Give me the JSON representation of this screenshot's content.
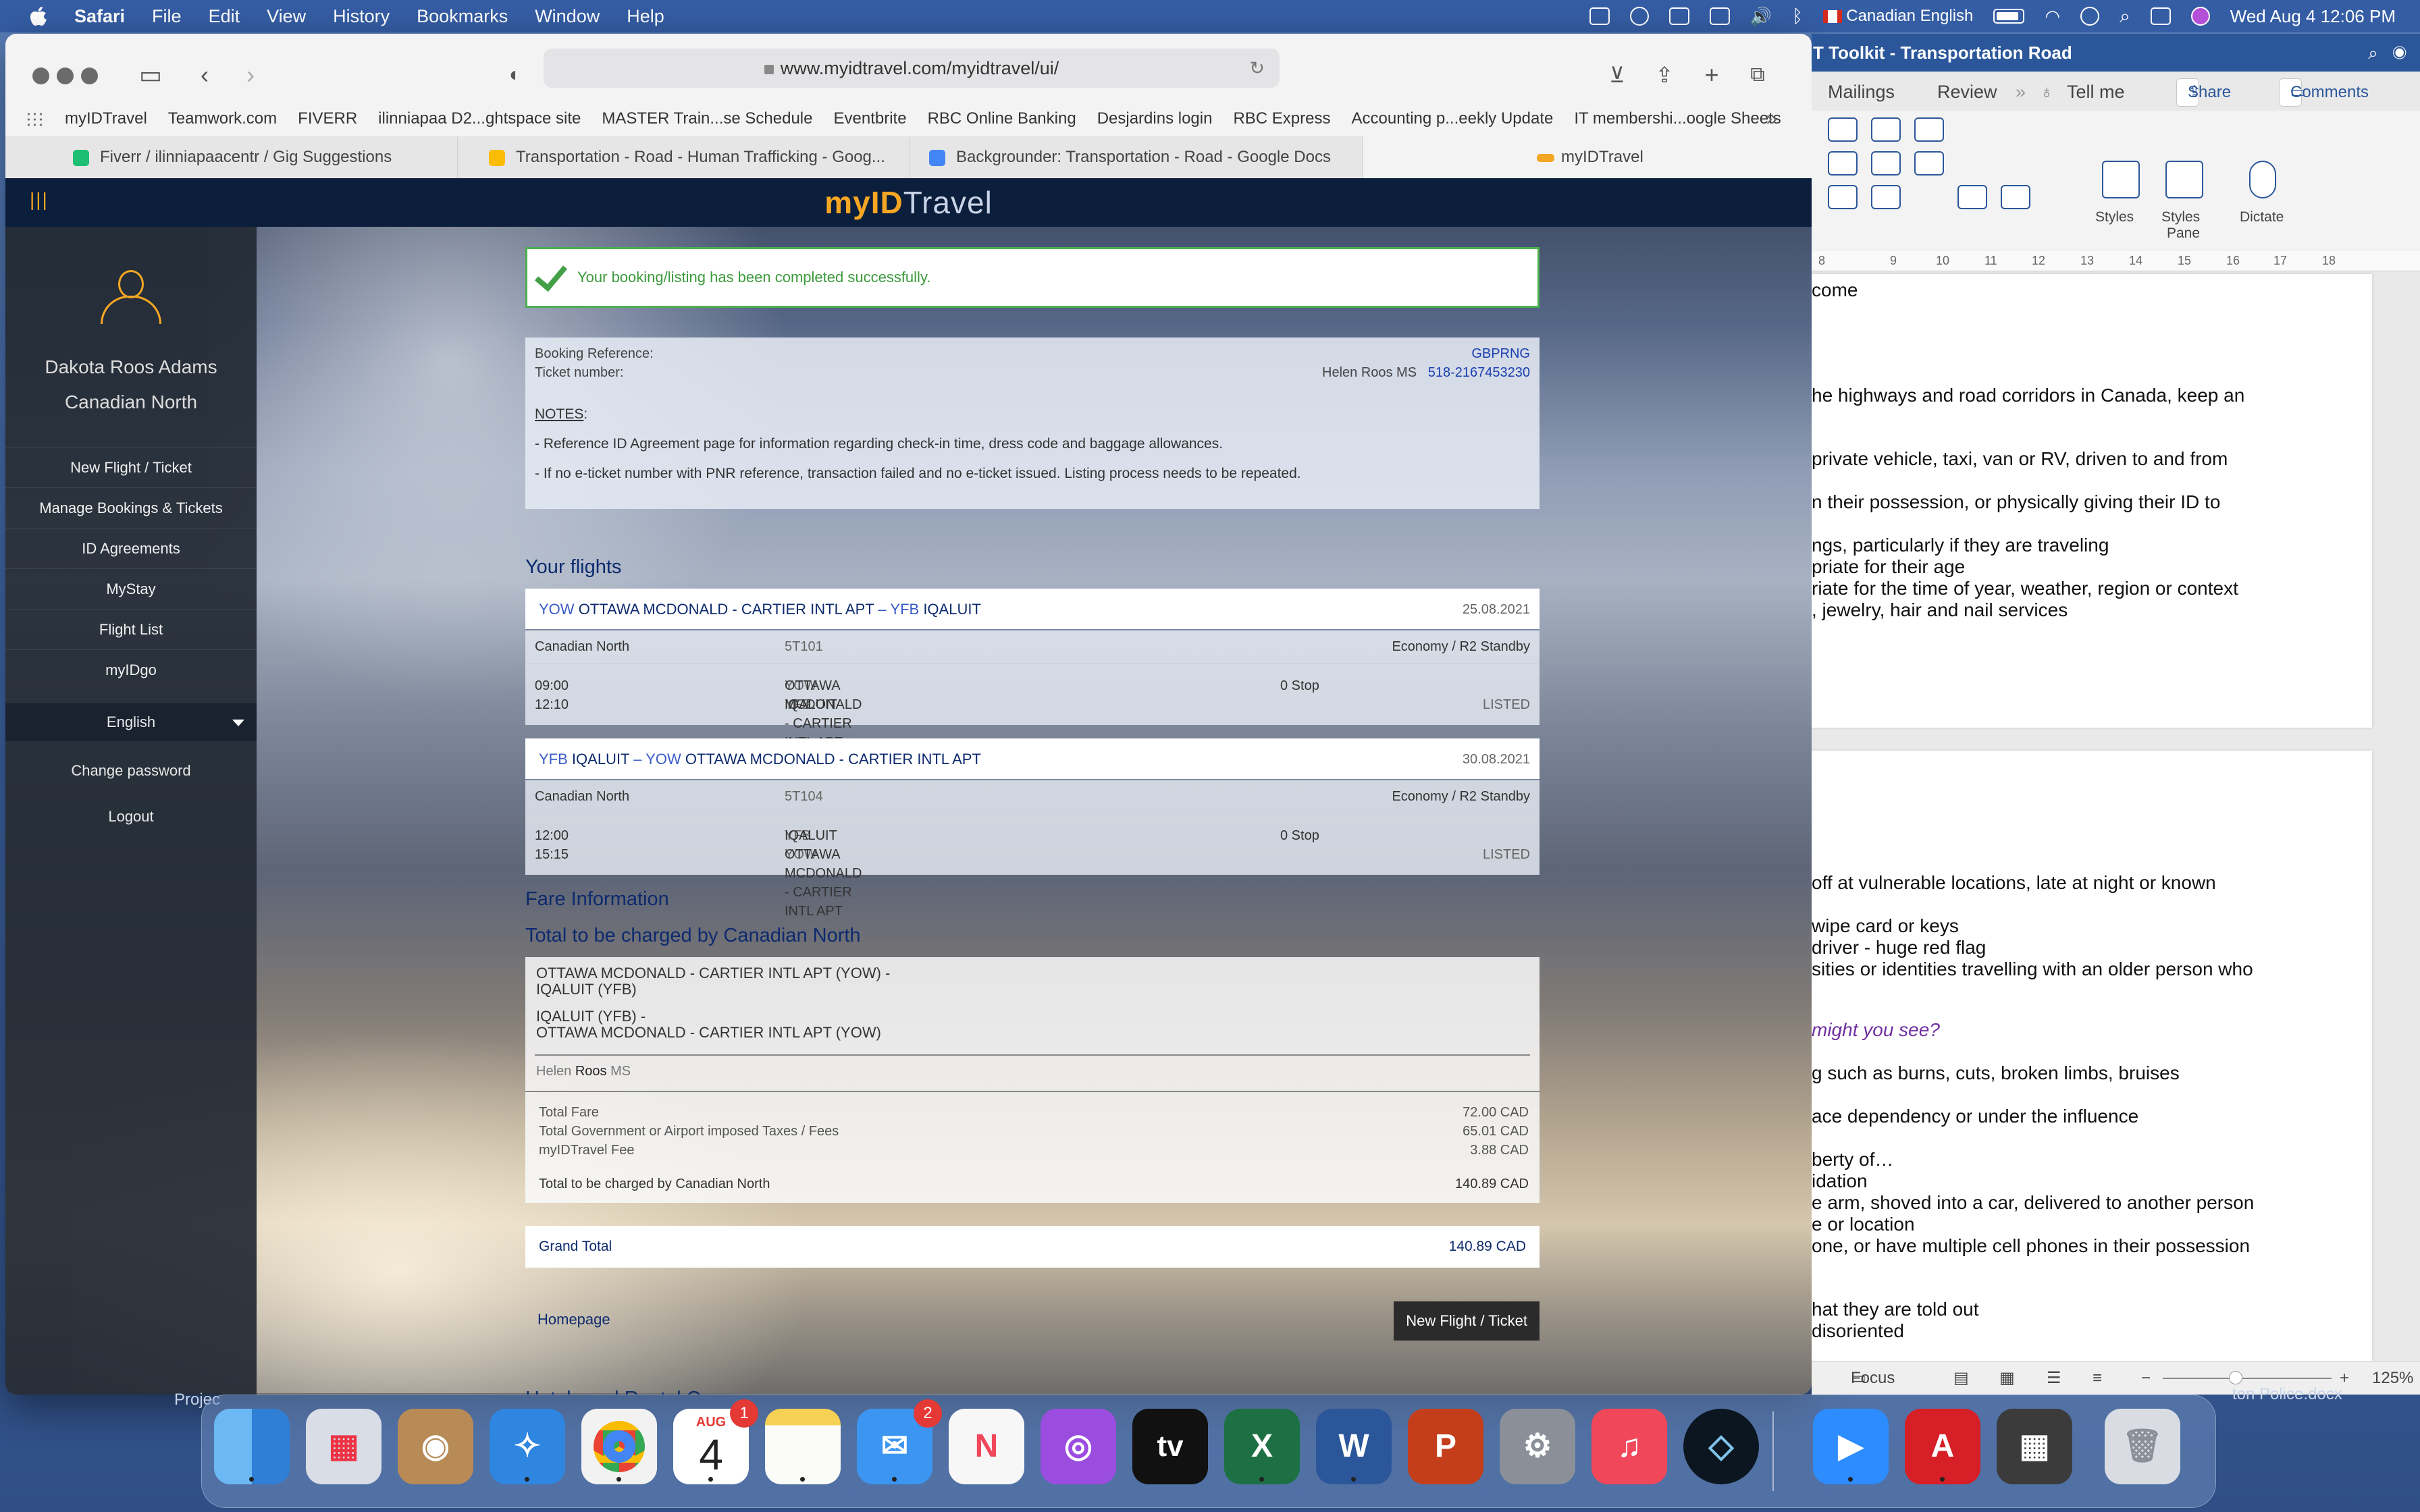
{
  "menubar": {
    "app": "Safari",
    "items": [
      "File",
      "Edit",
      "View",
      "History",
      "Bookmarks",
      "Window",
      "Help"
    ],
    "input_source": "Canadian English",
    "clock": "Wed Aug 4  12:06 PM"
  },
  "browser": {
    "url": "www.myidtravel.com/myidtravel/ui/",
    "favorites": [
      "myIDTravel",
      "Teamwork.com",
      "FIVERR",
      "ilinniapaa D2...ghtspace site",
      "MASTER Train...se Schedule",
      "Eventbrite",
      "RBC Online Banking",
      "Desjardins login",
      "RBC Express",
      "Accounting p...eekly Update",
      "IT membershi...oogle Sheets"
    ],
    "tabs": [
      {
        "label": "Fiverr / ilinniapaacentr / Gig Suggestions",
        "color": "#1dbf73"
      },
      {
        "label": "Transportation - Road - Human Trafficking - Goog...",
        "color": "#fbbc04"
      },
      {
        "label": "Backgrounder: Transportation - Road - Google Docs",
        "color": "#4285f4"
      },
      {
        "label": "myIDTravel",
        "color": "#f5a623"
      }
    ]
  },
  "site": {
    "menu_label": "Menu",
    "logo_a": "myID",
    "logo_b": "Travel"
  },
  "sidebar": {
    "user_name": "Dakota Roos Adams",
    "airline": "Canadian North",
    "items": [
      "New Flight / Ticket",
      "Manage Bookings & Tickets",
      "ID Agreements",
      "MyStay",
      "Flight List",
      "myIDgo"
    ],
    "language": "English",
    "change_password": "Change password",
    "logout": "Logout"
  },
  "booking": {
    "success": "Your booking/listing has been completed successfully.",
    "ref_label": "Booking Reference:",
    "ref_value": "GBPRNG",
    "ticket_label": "Ticket number:",
    "passenger": "Helen Roos MS",
    "ticket_value": "518-2167453230",
    "notes_title": "NOTES",
    "notes_colon": ":",
    "note1": "- Reference ID Agreement page for information regarding check-in time, dress code and baggage allowances.",
    "note2": "- If no e-ticket number with PNR reference, transaction failed and no e-ticket issued. Listing process needs to be repeated."
  },
  "flights_title": "Your flights",
  "flights": [
    {
      "from_code": "YOW",
      "from_name": "OTTAWA MCDONALD - CARTIER INTL APT",
      "to_code": "YFB",
      "to_name": "IQALUIT",
      "date": "25.08.2021",
      "airline": "Canadian North",
      "flight_no": "5T101",
      "cabin": "Economy / R2 Standby",
      "dep_time": "09:00",
      "arr_time": "12:10",
      "dep_code": "YOW",
      "dep_name": "OTTAWA MCDONALD - CARTIER INTL APT",
      "arr_code": "YFB",
      "arr_name": "IQALUIT",
      "stops": "0 Stop",
      "status": "LISTED"
    },
    {
      "from_code": "YFB",
      "from_name": "IQALUIT",
      "to_code": "YOW",
      "to_name": "OTTAWA MCDONALD - CARTIER INTL APT",
      "date": "30.08.2021",
      "airline": "Canadian North",
      "flight_no": "5T104",
      "cabin": "Economy / R2 Standby",
      "dep_time": "12:00",
      "arr_time": "15:15",
      "dep_code": "YFB",
      "dep_name": "IQALUIT",
      "arr_code": "YOW",
      "arr_name": "OTTAWA MCDONALD - CARTIER INTL APT",
      "stops": "0 Stop",
      "status": "LISTED"
    }
  ],
  "fare": {
    "title": "Fare Information",
    "subtitle": "Total to be charged by Canadian North",
    "route1a": "OTTAWA MCDONALD - CARTIER INTL APT (YOW) -",
    "route1b": "IQALUIT (YFB)",
    "route2a": "IQALUIT (YFB) -",
    "route2b": "OTTAWA MCDONALD - CARTIER INTL APT (YOW)",
    "pax_first": "Helen",
    "pax_last": "Roos",
    "pax_title": "MS",
    "total_fare_label": "Total Fare",
    "total_fare": "72.00 CAD",
    "taxes_label": "Total Government or Airport imposed Taxes / Fees",
    "taxes": "65.01 CAD",
    "fee_label": "myIDTravel Fee",
    "fee": "3.88 CAD",
    "charged_label": "Total to be charged by Canadian North",
    "charged": "140.89 CAD",
    "grand_label": "Grand Total",
    "grand": "140.89 CAD"
  },
  "homepage_link": "Homepage",
  "new_flight_button": "New Flight / Ticket",
  "hotels_title": "Hotels and Rental Cars",
  "word": {
    "title": "T Toolkit - Transportation Road",
    "tabs": [
      "Mailings",
      "Review",
      "Tell me"
    ],
    "share": "Share",
    "comments": "Comments",
    "ribbon_styles": "Styles",
    "ribbon_pane_1": "Styles",
    "ribbon_pane_2": "Pane",
    "ribbon_dictate": "Dictate",
    "ruler": [
      "8",
      "9",
      "10",
      "11",
      "12",
      "13",
      "14",
      "15",
      "16",
      "17",
      "18"
    ],
    "page1": [
      "come",
      "he highways and road corridors in Canada, keep an",
      "private vehicle, taxi, van or RV, driven to and from",
      "n their possession, or physically giving their ID to",
      "ngs, particularly if they are traveling",
      "priate for their age",
      "riate for the time of year, weather, region or context",
      ", jewelry, hair and nail services"
    ],
    "page2": [
      "off at vulnerable locations, late at night or known",
      "wipe card or keys",
      " driver - huge red flag",
      "sities or identities travelling with an older person who",
      "might you see?",
      "g such as burns, cuts, broken limbs, bruises",
      "ace dependency or under the influence",
      "berty of…",
      "idation",
      "e arm, shoved into a car, delivered to another person",
      "e or location",
      "one, or have multiple cell phones in their possession",
      "hat they are told out",
      " disoriented"
    ],
    "focus": "Focus",
    "zoom": "125%"
  },
  "desktop": {
    "left_label": "Projec",
    "right_label": "ton Police.docx"
  },
  "dock": [
    {
      "name": "Finder",
      "color": "#3a8ee6"
    },
    {
      "name": "Launchpad",
      "color": "#d8dde6"
    },
    {
      "name": "Contacts",
      "color": "#b88a55"
    },
    {
      "name": "Safari",
      "color": "#2f86e0"
    },
    {
      "name": "Chrome",
      "color": "#f2f2f2"
    },
    {
      "name": "Calendar",
      "color": "#ffffff",
      "text": "4",
      "month": "AUG",
      "badge": "1"
    },
    {
      "name": "Notes",
      "color": "#f7d154"
    },
    {
      "name": "Mail",
      "color": "#3c95f0",
      "badge": "2"
    },
    {
      "name": "News",
      "color": "#f7f7f7"
    },
    {
      "name": "Podcasts",
      "color": "#9b4de0"
    },
    {
      "name": "Apple TV",
      "color": "#111111",
      "text": "tv"
    },
    {
      "name": "Excel",
      "color": "#1d7044",
      "text": "X"
    },
    {
      "name": "Word",
      "color": "#2b579a",
      "text": "W"
    },
    {
      "name": "PowerPoint",
      "color": "#c43e1c",
      "text": "P"
    },
    {
      "name": "System Preferences",
      "color": "#8a8f98"
    },
    {
      "name": "Music",
      "color": "#f0475b"
    },
    {
      "name": "App",
      "color": "#0b1620"
    },
    {
      "name": "Zoom",
      "color": "#2d8cff"
    },
    {
      "name": "Acrobat",
      "color": "#d61f26"
    },
    {
      "name": "Calculator",
      "color": "#3b3b3b"
    },
    {
      "name": "Trash",
      "color": "#d9dde3"
    }
  ]
}
